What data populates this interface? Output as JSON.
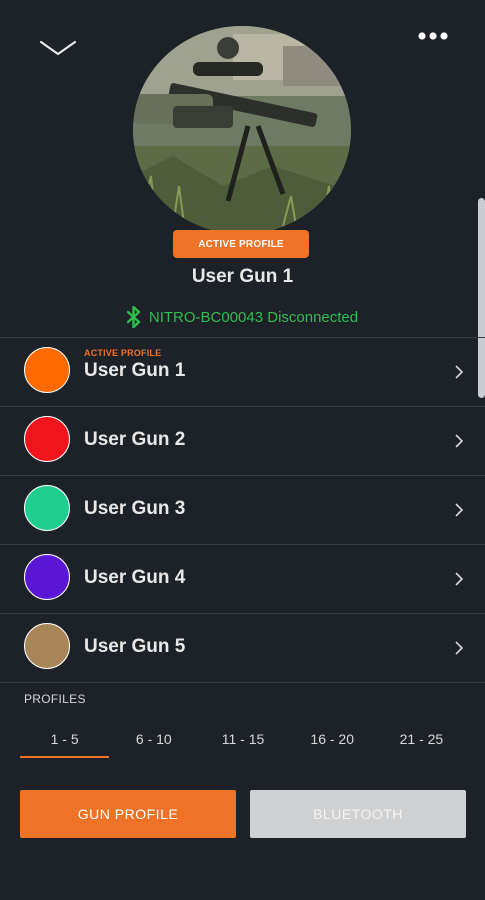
{
  "hero": {
    "badge": "ACTIVE PROFILE",
    "name": "User Gun 1",
    "device_status": "NITRO-BC00043 Disconnected",
    "device_status_color": "#2fbf4e"
  },
  "profiles": [
    {
      "name": "User Gun 1",
      "tag": "ACTIVE PROFILE",
      "color": "#ff6a00"
    },
    {
      "name": "User Gun 2",
      "tag": "",
      "color": "#f0141c"
    },
    {
      "name": "User Gun 3",
      "tag": "",
      "color": "#1fce8f"
    },
    {
      "name": "User Gun 4",
      "tag": "",
      "color": "#5b17d6"
    },
    {
      "name": "User Gun 5",
      "tag": "",
      "color": "#a88658"
    }
  ],
  "profiles_section": {
    "heading": "PROFILES",
    "tabs": [
      "1 - 5",
      "6 - 10",
      "11 - 15",
      "16 - 20",
      "21 - 25"
    ],
    "active_tab": "1 - 5"
  },
  "buttons": {
    "gun_profile": "GUN PROFILE",
    "bluetooth": "BLUETOOTH"
  },
  "icons": {
    "collapse": "chevron-down-icon",
    "more": "more-dots-icon",
    "bluetooth": "bluetooth-icon",
    "row_chevron": "chevron-right-icon"
  },
  "colors": {
    "accent": "#ef7327",
    "background": "#1d2128"
  }
}
